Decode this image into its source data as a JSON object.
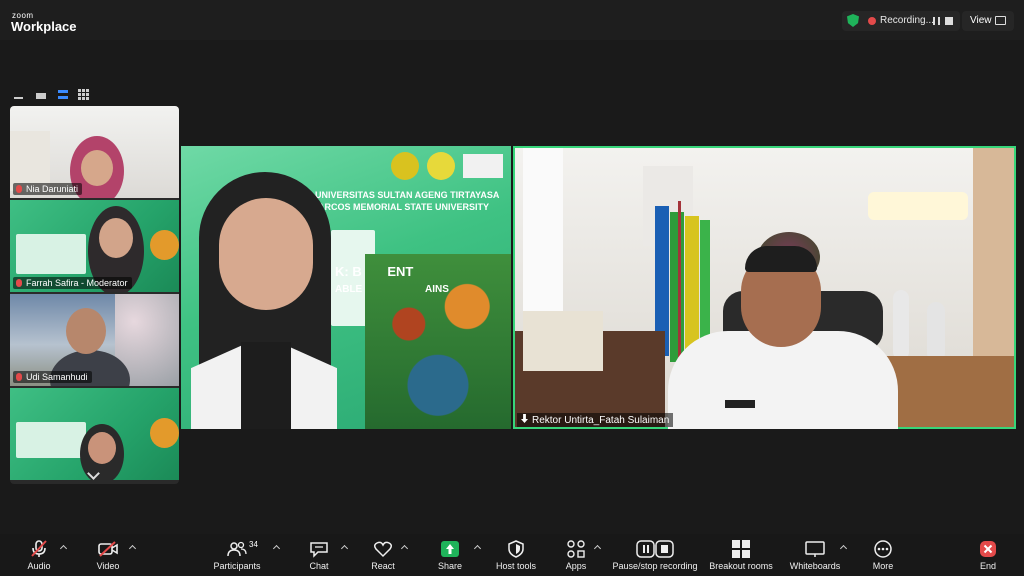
{
  "app": {
    "brand_small": "zoom",
    "brand_big": "Workplace"
  },
  "recording": {
    "status": "Recording...",
    "view_label": "View"
  },
  "participants_strip": [
    {
      "name": "Nia Daruniati",
      "muted": true
    },
    {
      "name": "Farrah Safira - Moderator",
      "muted": true
    },
    {
      "name": "Udi Samanhudi",
      "muted": true
    },
    {
      "name": "",
      "muted": false
    }
  ],
  "shared_slide": {
    "line1": "UNIVERSITAS SULTAN AGENG TIRTAYASA",
    "line2": "O MARCOS MEMORIAL STATE UNIVERSITY",
    "title_fragment_1": "K: B",
    "title_fragment_2": "ENT",
    "subtitle_fragment_1": "ABLE",
    "subtitle_fragment_2": "AINS"
  },
  "active_speaker": {
    "name": "Rektor Untirta_Fatah Sulaiman"
  },
  "toolbar": {
    "audio": "Audio",
    "video": "Video",
    "participants": "Participants",
    "participants_count": "34",
    "chat": "Chat",
    "react": "React",
    "share": "Share",
    "host_tools": "Host tools",
    "apps": "Apps",
    "recording_control": "Pause/stop recording",
    "breakout": "Breakout rooms",
    "whiteboards": "Whiteboards",
    "more": "More",
    "end": "End"
  },
  "colors": {
    "accent_green": "#37d67a",
    "share_green": "#1fb35a",
    "end_red": "#e34a4a",
    "mute_red": "#e34a4a"
  }
}
